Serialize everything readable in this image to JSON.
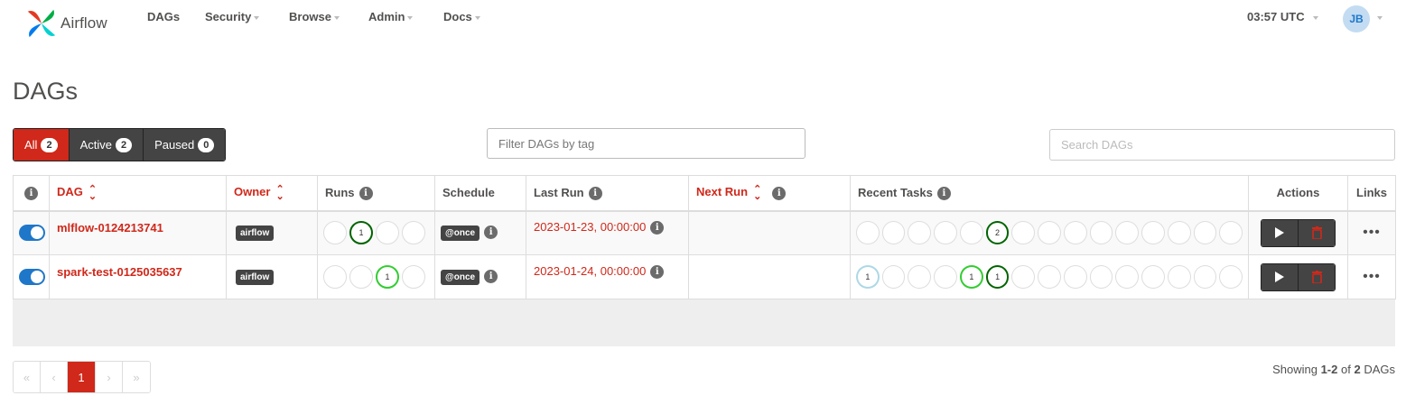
{
  "navbar": {
    "brand": "Airflow",
    "items": [
      {
        "label": "DAGs",
        "caret": false
      },
      {
        "label": "Security",
        "caret": true
      },
      {
        "label": "Browse",
        "caret": true
      },
      {
        "label": "Admin",
        "caret": true
      },
      {
        "label": "Docs",
        "caret": true
      }
    ],
    "clock": "03:57 UTC",
    "user_initials": "JB"
  },
  "page": {
    "title": "DAGs"
  },
  "filters": {
    "all_label": "All",
    "all_count": "2",
    "active_label": "Active",
    "active_count": "2",
    "paused_label": "Paused",
    "paused_count": "0"
  },
  "tag_filter": {
    "placeholder": "Filter DAGs by tag"
  },
  "search": {
    "placeholder": "Search DAGs"
  },
  "table": {
    "headers": {
      "dag": "DAG",
      "owner": "Owner",
      "runs": "Runs",
      "schedule": "Schedule",
      "last_run": "Last Run",
      "next_run": "Next Run",
      "recent_tasks": "Recent Tasks",
      "actions": "Actions",
      "links": "Links"
    },
    "rows": [
      {
        "dag_id": "mlflow-0124213741",
        "owner": "airflow",
        "schedule": "@once",
        "last_run": "2023-01-23, 00:00:00",
        "next_run": "",
        "runs": [
          {
            "state": "",
            "count": ""
          },
          {
            "state": "success",
            "count": "1"
          },
          {
            "state": "",
            "count": ""
          },
          {
            "state": "",
            "count": ""
          }
        ],
        "tasks": [
          {
            "state": "",
            "count": ""
          },
          {
            "state": "",
            "count": ""
          },
          {
            "state": "",
            "count": ""
          },
          {
            "state": "",
            "count": ""
          },
          {
            "state": "",
            "count": ""
          },
          {
            "state": "success",
            "count": "2"
          },
          {
            "state": "",
            "count": ""
          },
          {
            "state": "",
            "count": ""
          },
          {
            "state": "",
            "count": ""
          },
          {
            "state": "",
            "count": ""
          },
          {
            "state": "",
            "count": ""
          },
          {
            "state": "",
            "count": ""
          },
          {
            "state": "",
            "count": ""
          },
          {
            "state": "",
            "count": ""
          },
          {
            "state": "",
            "count": ""
          }
        ]
      },
      {
        "dag_id": "spark-test-0125035637",
        "owner": "airflow",
        "schedule": "@once",
        "last_run": "2023-01-24, 00:00:00",
        "next_run": "",
        "runs": [
          {
            "state": "",
            "count": ""
          },
          {
            "state": "",
            "count": ""
          },
          {
            "state": "running",
            "count": "1"
          },
          {
            "state": "",
            "count": ""
          }
        ],
        "tasks": [
          {
            "state": "queued",
            "count": "1"
          },
          {
            "state": "",
            "count": ""
          },
          {
            "state": "",
            "count": ""
          },
          {
            "state": "",
            "count": ""
          },
          {
            "state": "running",
            "count": "1"
          },
          {
            "state": "success",
            "count": "1"
          },
          {
            "state": "",
            "count": ""
          },
          {
            "state": "",
            "count": ""
          },
          {
            "state": "",
            "count": ""
          },
          {
            "state": "",
            "count": ""
          },
          {
            "state": "",
            "count": ""
          },
          {
            "state": "",
            "count": ""
          },
          {
            "state": "",
            "count": ""
          },
          {
            "state": "",
            "count": ""
          },
          {
            "state": "",
            "count": ""
          }
        ]
      }
    ]
  },
  "pagination": {
    "first": "«",
    "prev": "‹",
    "current": "1",
    "next": "›",
    "last": "»"
  },
  "showing": {
    "prefix": "Showing",
    "range": "1-2",
    "of": "of",
    "total": "2",
    "suffix": "DAGs"
  },
  "colors": {
    "accent": "#d0281a",
    "toggle": "#1f77c9",
    "success": "#006400",
    "running": "#32cd32",
    "queued": "#add8e6"
  },
  "icons": {
    "info": "info-icon",
    "sort": "sort-icon",
    "play": "play-icon",
    "delete": "trash-icon",
    "more": "ellipsis-icon"
  }
}
